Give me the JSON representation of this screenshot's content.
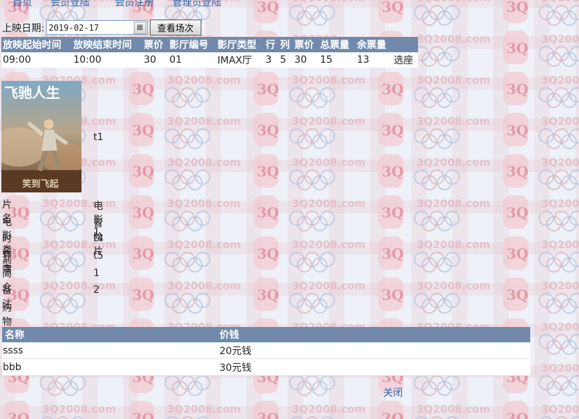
{
  "nav": {
    "home": "首页",
    "member_login": "会员登陆",
    "member_register": "会员注册",
    "admin_login": "管理员登陆"
  },
  "watermark": {
    "text": "3Q2008.com",
    "logo_letters": "3Q"
  },
  "search": {
    "date_label": "上映日期:",
    "date_value": "2019-02-17",
    "query_button": "查看场次"
  },
  "showtimes": {
    "headers": [
      "放映起始时间",
      "放映结束时间",
      "票价",
      "影厅编号",
      "影厅类型",
      "行",
      "列",
      "票价",
      "总票量",
      "余票量"
    ],
    "rows": [
      {
        "start": "09:00",
        "end": "10:00",
        "price": "30",
        "hall_no": "01",
        "hall_type": "IMAX厅",
        "row": "3",
        "col": "5",
        "ticket_price": "30",
        "total": "15",
        "remaining": "13",
        "action": "选座"
      }
    ]
  },
  "poster": {
    "title_art": "飞驰人生",
    "subtitle_art": "笑到飞起",
    "extra_text": "t1"
  },
  "movie_info": [
    {
      "label": "片名",
      "value": "电影1"
    },
    {
      "label": "电影类型",
      "value": "冒险片"
    },
    {
      "label": "时长",
      "value": "t4"
    },
    {
      "label": "导演",
      "value": "t5"
    },
    {
      "label": "简介",
      "value": "1"
    },
    {
      "label": "备注",
      "value": "2"
    },
    {
      "label": "购物",
      "value": ""
    }
  ],
  "goods": {
    "headers": [
      "名称",
      "价钱"
    ],
    "rows": [
      {
        "name": "ssss",
        "price": "20元钱"
      },
      {
        "name": "bbb",
        "price": "30元钱"
      }
    ]
  },
  "close_link": "关闭",
  "colors": {
    "header_bg": "#7189ab",
    "link": "#2d63a8",
    "page_bg": "#eef1f7"
  }
}
